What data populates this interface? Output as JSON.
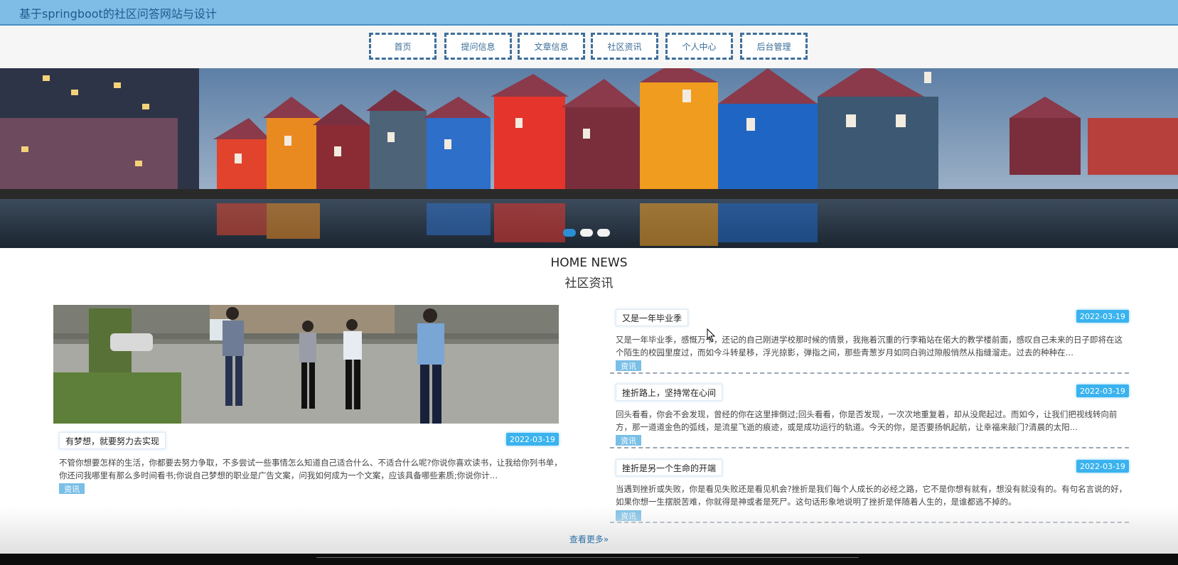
{
  "header": {
    "title": "基于springboot的社区问答网站与设计"
  },
  "nav": {
    "items": [
      "首页",
      "提问信息",
      "文章信息",
      "社区资讯",
      "个人中心",
      "后台管理"
    ]
  },
  "banner": {
    "slides": 3,
    "active_index": 0
  },
  "section": {
    "title_en": "HOME NEWS",
    "title_cn": "社区资讯"
  },
  "featured": {
    "title": "有梦想，就要努力去实现",
    "date": "2022-03-19",
    "summary": "不管你想要怎样的生活，你都要去努力争取，不多尝试一些事情怎么知道自己适合什么、不适合什么呢?你说你喜欢读书，让我给你列书单，你还问我哪里有那么多时间看书;你说自己梦想的职业是广告文案，问我如何成为一个文案，应该具备哪些素质;你说你计…",
    "tag": "资讯"
  },
  "news_list": [
    {
      "title": "又是一年毕业季",
      "date": "2022-03-19",
      "summary": "又是一年毕业季，感慨万千，还记的自己刚进学校那时候的情景，我拖着沉重的行李箱站在偌大的教学楼前面，感叹自己未来的日子即将在这个陌生的校园里度过，而如今斗转星移，浮光掠影，弹指之间，那些青葱岁月如同白驹过隙般悄然从指缝溜走。过去的种种在…",
      "tag": "资讯"
    },
    {
      "title": "挫折路上，坚持常在心间",
      "date": "2022-03-19",
      "summary": "回头看看，你会不会发现，曾经的你在这里摔倒过;回头看看，你是否发现，一次次地重复着，却从没爬起过。而如今，让我们把视线转向前方，那一道道金色的弧线，是流星飞逝的痕迹，或是成功运行的轨道。今天的你，是否要扬帆起航，让幸福来敲门?清晨的太阳…",
      "tag": "资讯"
    },
    {
      "title": "挫折是另一个生命的开端",
      "date": "2022-03-19",
      "summary": "当遇到挫折或失败，你是看见失败还是看见机会?挫折是我们每个人成长的必经之路，它不是你想有就有，想没有就没有的。有句名言说的好，如果你想一生摆脱苦难，你就得是神或者是死尸。这句话形象地说明了挫折是伴随着人生的，是谁都逃不掉的。",
      "tag": "资讯"
    }
  ],
  "more_link": "查看更多»"
}
